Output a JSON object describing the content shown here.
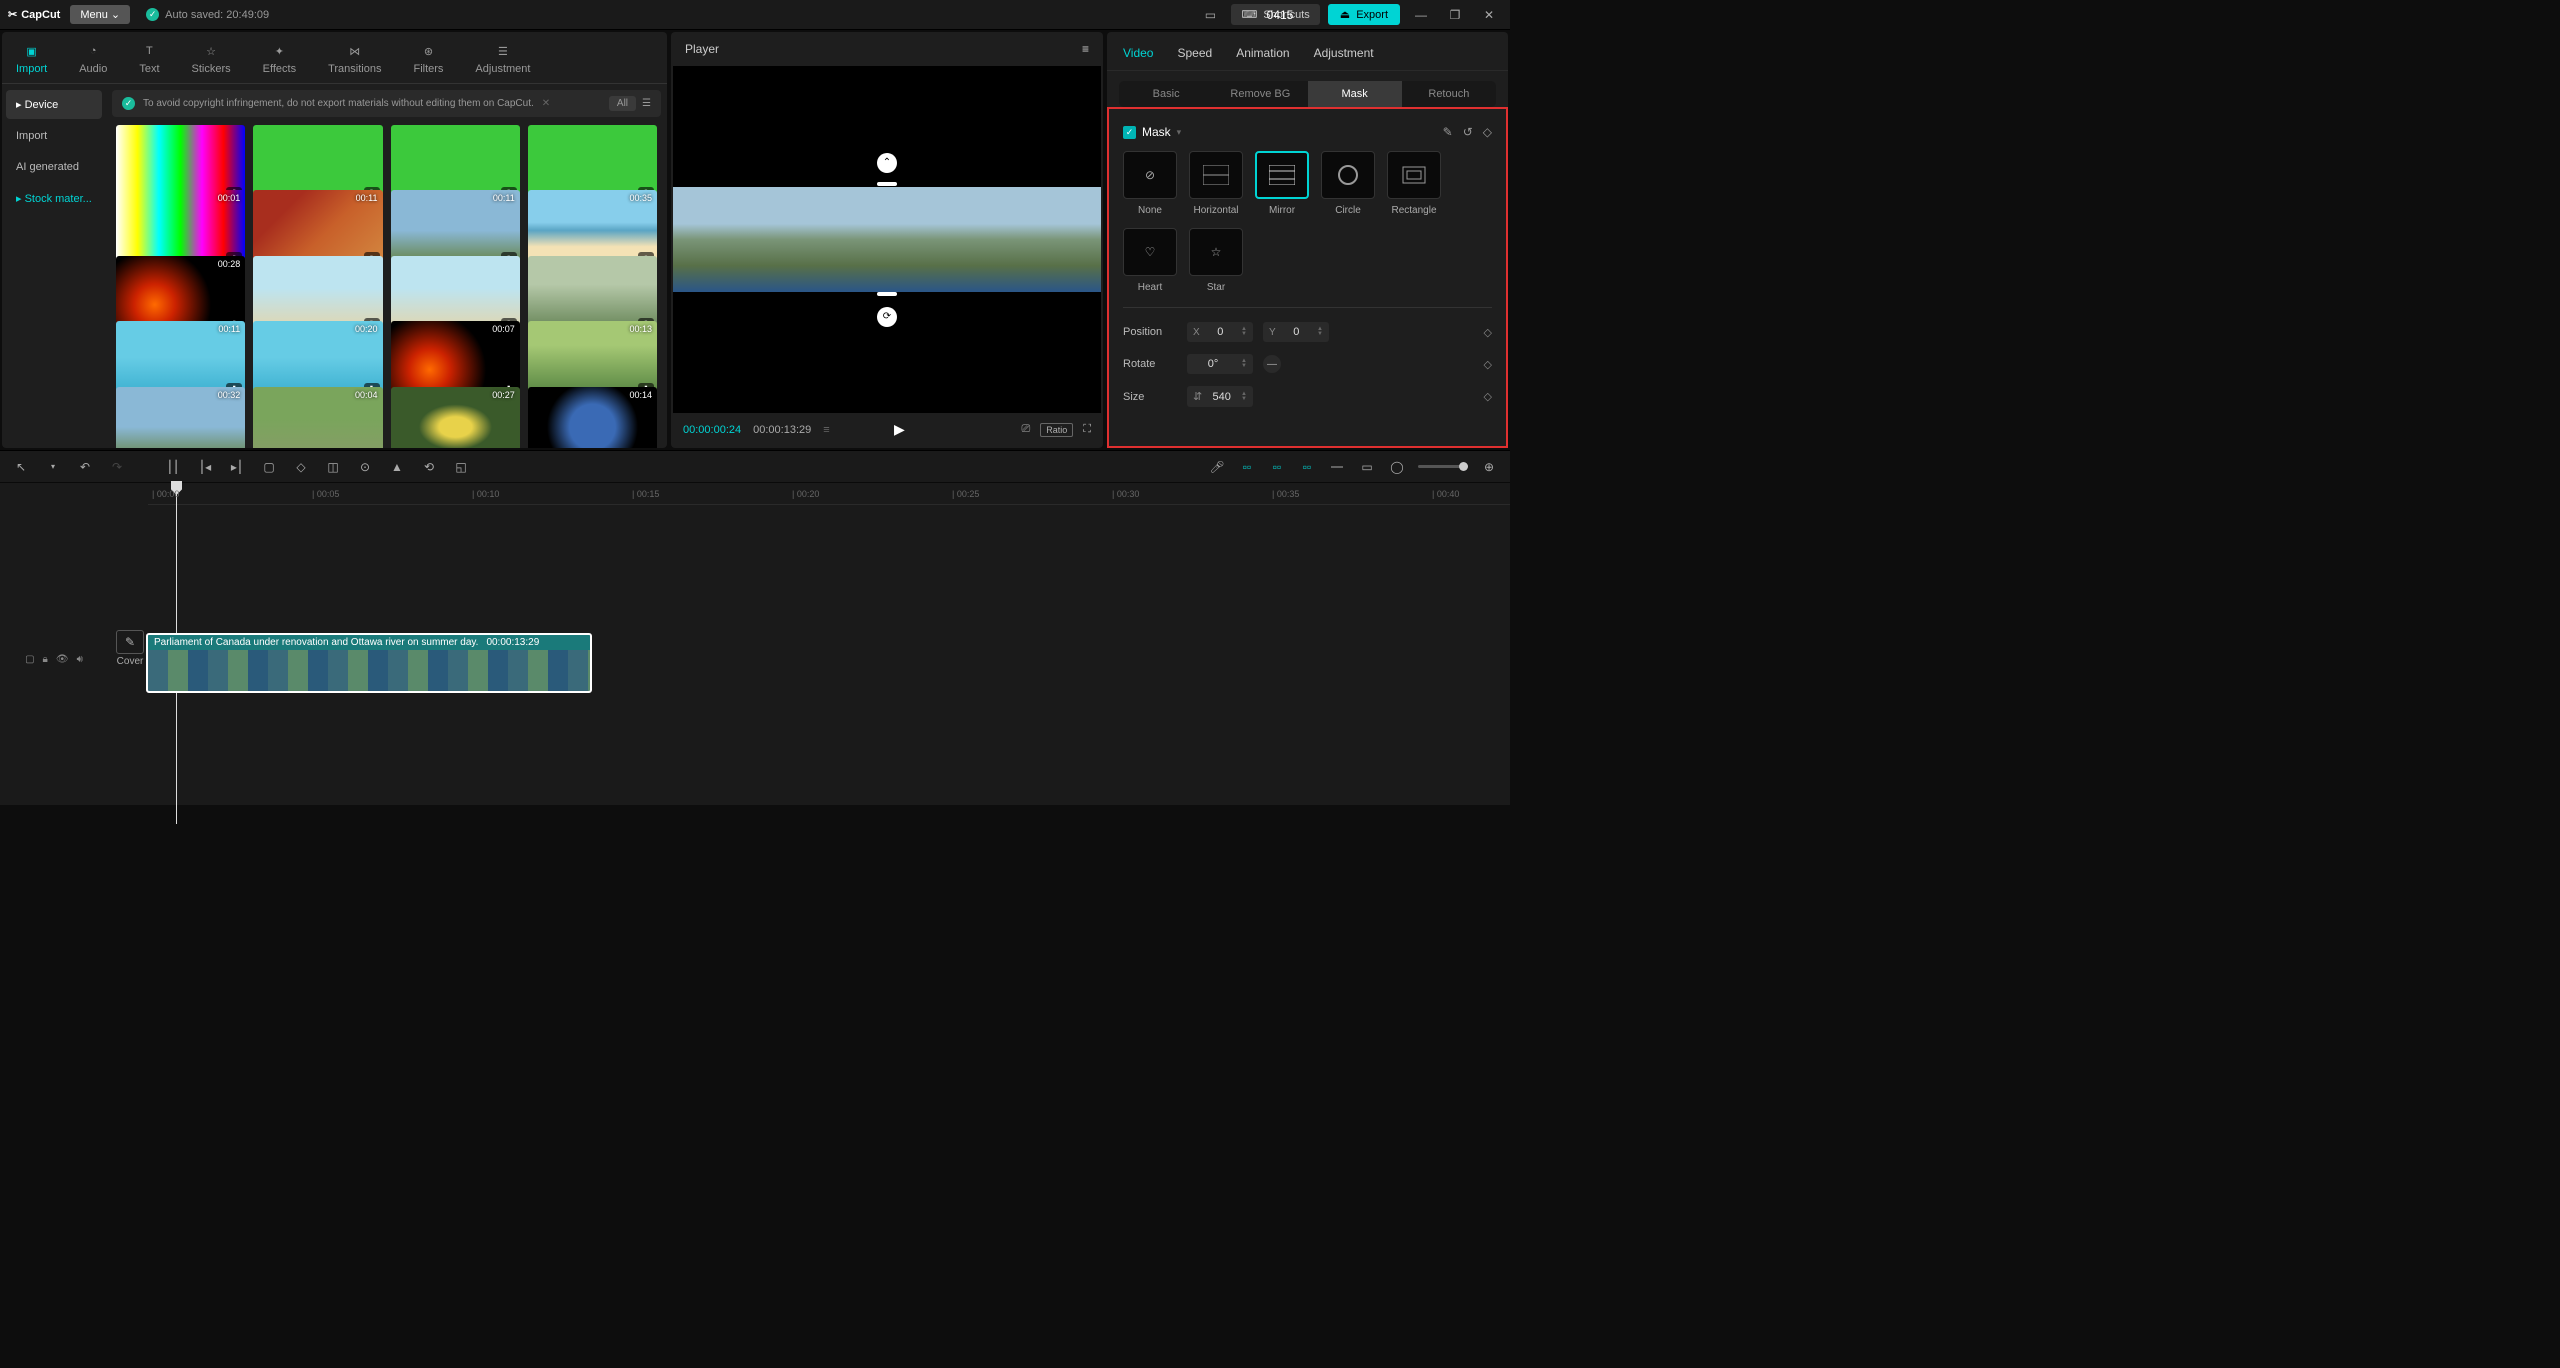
{
  "app": {
    "name": "CapCut",
    "menu": "Menu",
    "autosave": "Auto saved: 20:49:09",
    "project_title": "0415"
  },
  "titlebar": {
    "shortcuts": "Shortcuts",
    "export": "Export"
  },
  "top_tabs": [
    "Import",
    "Audio",
    "Text",
    "Stickers",
    "Effects",
    "Transitions",
    "Filters",
    "Adjustment"
  ],
  "sidebar": {
    "items": [
      "Device",
      "Import",
      "AI generated",
      "Stock mater..."
    ]
  },
  "warning": {
    "text": "To avoid copyright infringement, do not export materials without editing them on CapCut.",
    "all": "All"
  },
  "media": [
    {
      "dur": "",
      "cls": "thumb-bars"
    },
    {
      "dur": "",
      "cls": "thumb-green"
    },
    {
      "dur": "",
      "cls": "thumb-green"
    },
    {
      "dur": "",
      "cls": "thumb-green"
    },
    {
      "dur": "00:01",
      "cls": "thumb-bars"
    },
    {
      "dur": "00:11",
      "cls": "thumb-lanterns"
    },
    {
      "dur": "00:11",
      "cls": "thumb-city"
    },
    {
      "dur": "00:35",
      "cls": "thumb-beach"
    },
    {
      "dur": "00:28",
      "cls": "thumb-fire"
    },
    {
      "dur": "",
      "cls": "thumb-group"
    },
    {
      "dur": "",
      "cls": "thumb-group"
    },
    {
      "dur": "",
      "cls": "thumb-forest"
    },
    {
      "dur": "00:11",
      "cls": "thumb-pool"
    },
    {
      "dur": "00:20",
      "cls": "thumb-pool"
    },
    {
      "dur": "00:07",
      "cls": "thumb-fire"
    },
    {
      "dur": "00:13",
      "cls": "thumb-park"
    },
    {
      "dur": "00:32",
      "cls": "thumb-city"
    },
    {
      "dur": "00:04",
      "cls": "thumb-cat"
    },
    {
      "dur": "00:27",
      "cls": "thumb-flowers"
    },
    {
      "dur": "00:14",
      "cls": "thumb-earth"
    }
  ],
  "player": {
    "title": "Player",
    "current": "00:00:00:24",
    "total": "00:00:13:29",
    "ratio": "Ratio"
  },
  "inspector": {
    "tabs": [
      "Video",
      "Speed",
      "Animation",
      "Adjustment"
    ],
    "subtabs": [
      "Basic",
      "Remove BG",
      "Mask",
      "Retouch"
    ],
    "mask_title": "Mask",
    "mask_options": [
      "None",
      "Horizontal",
      "Mirror",
      "Circle",
      "Rectangle",
      "Heart",
      "Star"
    ],
    "position_label": "Position",
    "x_label": "X",
    "x_val": "0",
    "y_label": "Y",
    "y_val": "0",
    "rotate_label": "Rotate",
    "rotate_val": "0°",
    "size_label": "Size",
    "size_val": "540"
  },
  "timeline": {
    "ticks": [
      "00:00",
      "00:05",
      "00:10",
      "00:15",
      "00:20",
      "00:25",
      "00:30",
      "00:35",
      "00:40"
    ],
    "clip_title": "Parliament of Canada under renovation and Ottawa river on summer day.",
    "clip_dur": "00:00:13:29",
    "cover": "Cover"
  }
}
